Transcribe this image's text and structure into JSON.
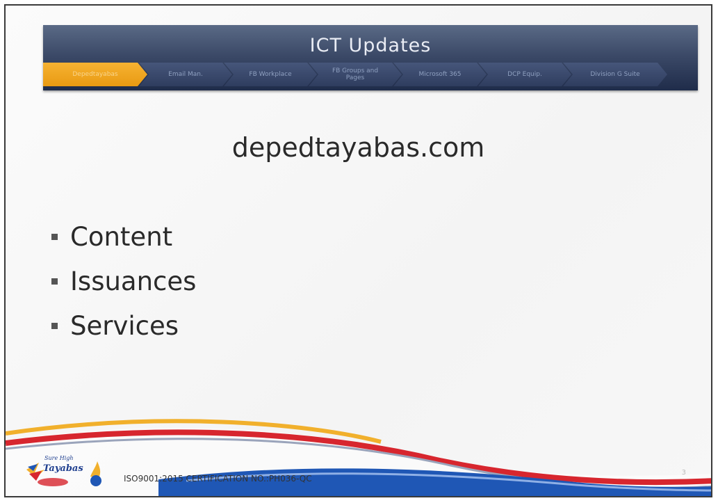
{
  "header": {
    "title": "ICT Updates",
    "nav": [
      {
        "label": "Depedtayabas",
        "active": true
      },
      {
        "label": "Email Man.",
        "active": false
      },
      {
        "label": "FB Workplace",
        "active": false
      },
      {
        "label": "FB Groups and Pages",
        "active": false
      },
      {
        "label": "Microsoft 365",
        "active": false
      },
      {
        "label": "DCP Equip.",
        "active": false
      },
      {
        "label": "Division G Suite",
        "active": false
      }
    ]
  },
  "main": {
    "site_title": "depedtayabas.com",
    "bullets": [
      "Content",
      "Issuances",
      "Services"
    ]
  },
  "footer": {
    "logo_text": "Sure High Tayabas",
    "certification": "ISO9001:2015 CERTIFICATION NO.:PH036-QC",
    "page_number": "3"
  },
  "colors": {
    "header_dark": "#1f2c4a",
    "active_tab": "#f0a424",
    "swoosh_red": "#d7262e",
    "swoosh_blue": "#1f57b5",
    "swoosh_gold": "#f1b02c"
  }
}
